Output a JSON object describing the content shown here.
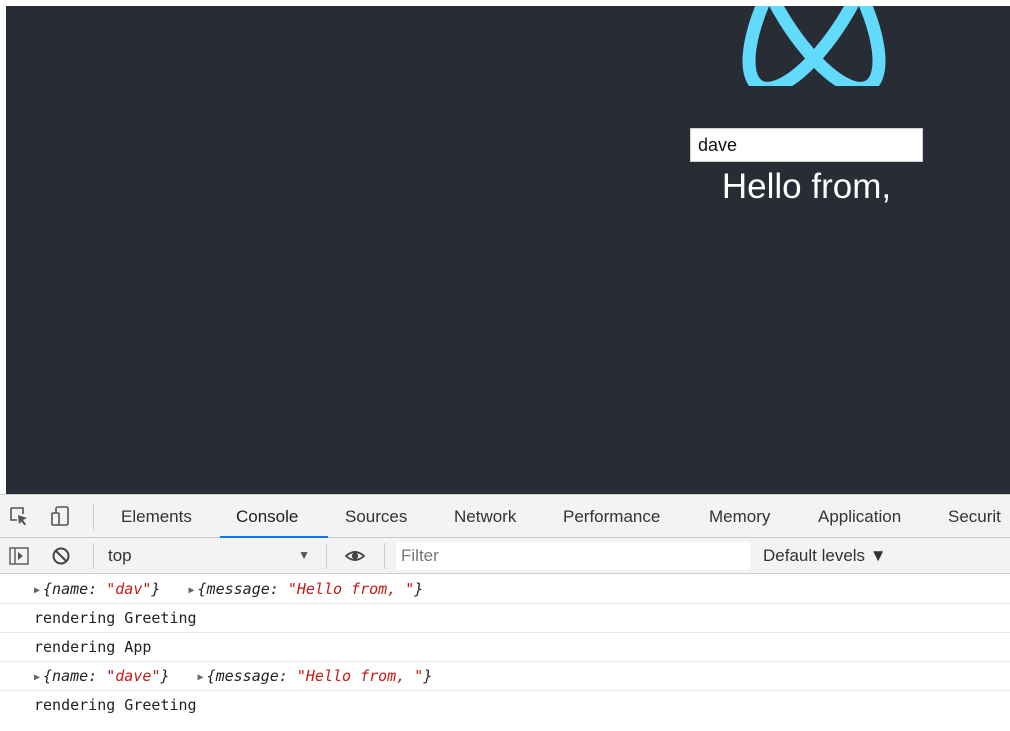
{
  "app": {
    "input_value": "dave",
    "greeting": "Hello from,"
  },
  "devtools": {
    "tabs": [
      "Elements",
      "Console",
      "Sources",
      "Network",
      "Performance",
      "Memory",
      "Application",
      "Securit"
    ],
    "active_tab": "Console",
    "context": "top",
    "filter_placeholder": "Filter",
    "levels_label": "Default levels ▼"
  },
  "console": {
    "row1": {
      "a_key": "{name: ",
      "a_val": "\"dav\"",
      "a_close": "}",
      "b_key": "{message: ",
      "b_val": "\"Hello from, \"",
      "b_close": "}"
    },
    "row2": "rendering Greeting",
    "row3": "rendering App",
    "row4": {
      "a_key": "{name: ",
      "a_val": "\"dave\"",
      "a_close": "}",
      "b_key": "{message: ",
      "b_val": "\"Hello from, \"",
      "b_close": "}"
    },
    "row5": "rendering Greeting"
  },
  "colors": {
    "app_bg": "#282c34",
    "react_blue": "#61dafb",
    "tab_underline": "#1a73e8",
    "string_red": "#c41a16"
  },
  "icons": [
    "react-logo",
    "inspect-element-icon",
    "device-toolbar-icon",
    "sidebar-toggle-icon",
    "clear-console-icon",
    "live-expression-eye-icon",
    "dropdown-arrow-icon",
    "expand-triangle-icon"
  ]
}
